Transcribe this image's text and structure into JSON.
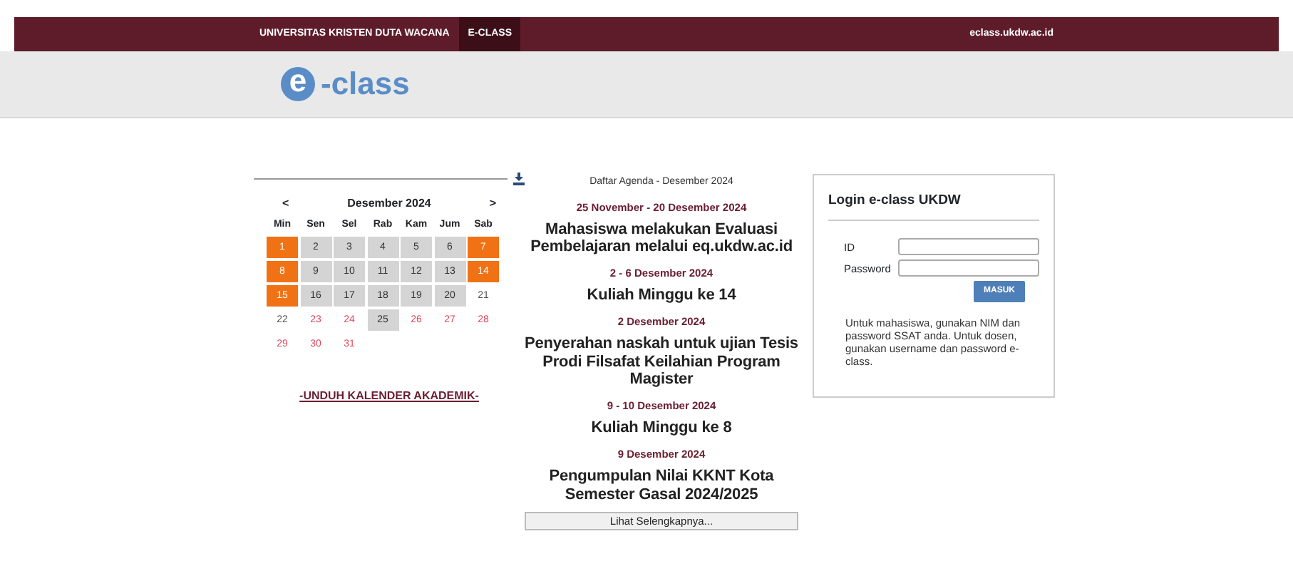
{
  "navbar": {
    "brand": "UNIVERSITAS KRISTEN DUTA WACANA",
    "items": [
      {
        "label": "E-CLASS",
        "selected": true
      }
    ],
    "site": "eclass.ukdw.ac.id"
  },
  "logo": {
    "letter": "e",
    "text": "-class"
  },
  "calendar": {
    "prev": "<",
    "next": ">",
    "month": "Desember 2024",
    "weekdays": [
      "Min",
      "Sen",
      "Sel",
      "Rab",
      "Kam",
      "Jum",
      "Sab"
    ],
    "weeks": [
      [
        {
          "day": "1",
          "kind": "holiday"
        },
        {
          "day": "2",
          "kind": "event"
        },
        {
          "day": "3",
          "kind": "event"
        },
        {
          "day": "4",
          "kind": "event"
        },
        {
          "day": "5",
          "kind": "event"
        },
        {
          "day": "6",
          "kind": "event"
        },
        {
          "day": "7",
          "kind": "holiday"
        }
      ],
      [
        {
          "day": "8",
          "kind": "holiday"
        },
        {
          "day": "9",
          "kind": "event"
        },
        {
          "day": "10",
          "kind": "event"
        },
        {
          "day": "11",
          "kind": "event"
        },
        {
          "day": "12",
          "kind": "event"
        },
        {
          "day": "13",
          "kind": "event"
        },
        {
          "day": "14",
          "kind": "holiday"
        }
      ],
      [
        {
          "day": "15",
          "kind": "holiday"
        },
        {
          "day": "16",
          "kind": "event"
        },
        {
          "day": "17",
          "kind": "event"
        },
        {
          "day": "18",
          "kind": "event"
        },
        {
          "day": "19",
          "kind": "event"
        },
        {
          "day": "20",
          "kind": "event"
        },
        {
          "day": "21",
          "kind": "plain"
        }
      ],
      [
        {
          "day": "22",
          "kind": "plain"
        },
        {
          "day": "23",
          "kind": "off"
        },
        {
          "day": "24",
          "kind": "off"
        },
        {
          "day": "25",
          "kind": "event"
        },
        {
          "day": "26",
          "kind": "off"
        },
        {
          "day": "27",
          "kind": "off"
        },
        {
          "day": "28",
          "kind": "off"
        }
      ],
      [
        {
          "day": "29",
          "kind": "off"
        },
        {
          "day": "30",
          "kind": "off"
        },
        {
          "day": "31",
          "kind": "off"
        }
      ]
    ]
  },
  "download_link": "-UNDUH KALENDER AKADEMIK-",
  "agenda": {
    "title": "Daftar Agenda - Desember 2024",
    "items": [
      {
        "date": "25 November - 20 Desember 2024",
        "title": "Mahasiswa melakukan Evaluasi Pembelajaran melalui eq.ukdw.ac.id"
      },
      {
        "date": "2 - 6 Desember 2024",
        "title": "Kuliah Minggu ke 14"
      },
      {
        "date": "2 Desember 2024",
        "title": "Penyerahan naskah untuk ujian Tesis Prodi Filsafat Keilahian Program Magister"
      },
      {
        "date": "9 - 10 Desember 2024",
        "title": "Kuliah Minggu ke 8"
      },
      {
        "date": "9 Desember 2024",
        "title": "Pengumpulan Nilai KKNT Kota Semester Gasal 2024/2025"
      }
    ],
    "more": "Lihat Selengkapnya..."
  },
  "login": {
    "title": "Login e-class UKDW",
    "fields": [
      {
        "label": "ID"
      },
      {
        "label": "Password"
      }
    ],
    "button": "MASUK",
    "note": "Untuk mahasiswa, gunakan NIM dan password SSAT anda. Untuk dosen, gunakan username dan password e-class."
  }
}
